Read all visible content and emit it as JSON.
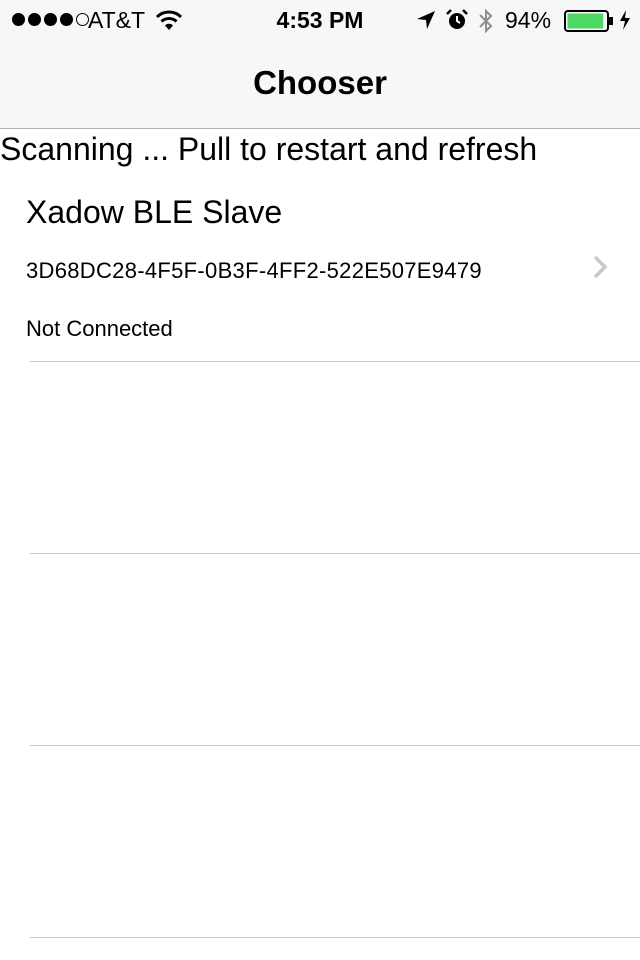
{
  "status_bar": {
    "carrier": "AT&T",
    "time": "4:53 PM",
    "battery_percent": "94%",
    "signal_strength_bars": 4,
    "signal_max_bars": 5,
    "battery_level": 0.94,
    "battery_color": "#4cd964",
    "icons": [
      "wifi-icon",
      "location-arrow-icon",
      "alarm-clock-icon",
      "bluetooth-icon",
      "battery-icon",
      "charging-bolt-icon"
    ]
  },
  "nav": {
    "title": "Chooser"
  },
  "scan_status": "Scanning ... Pull to restart and refresh",
  "devices": [
    {
      "name": "Xadow BLE Slave",
      "uuid": "3D68DC28-4F5F-0B3F-4FF2-522E507E9479",
      "connection_status": "Not Connected",
      "accessory": "chevron-right-icon"
    }
  ],
  "colors": {
    "bar_background": "#f7f7f7",
    "separator": "#c8c7cc",
    "chevron": "#c7c7cc"
  }
}
